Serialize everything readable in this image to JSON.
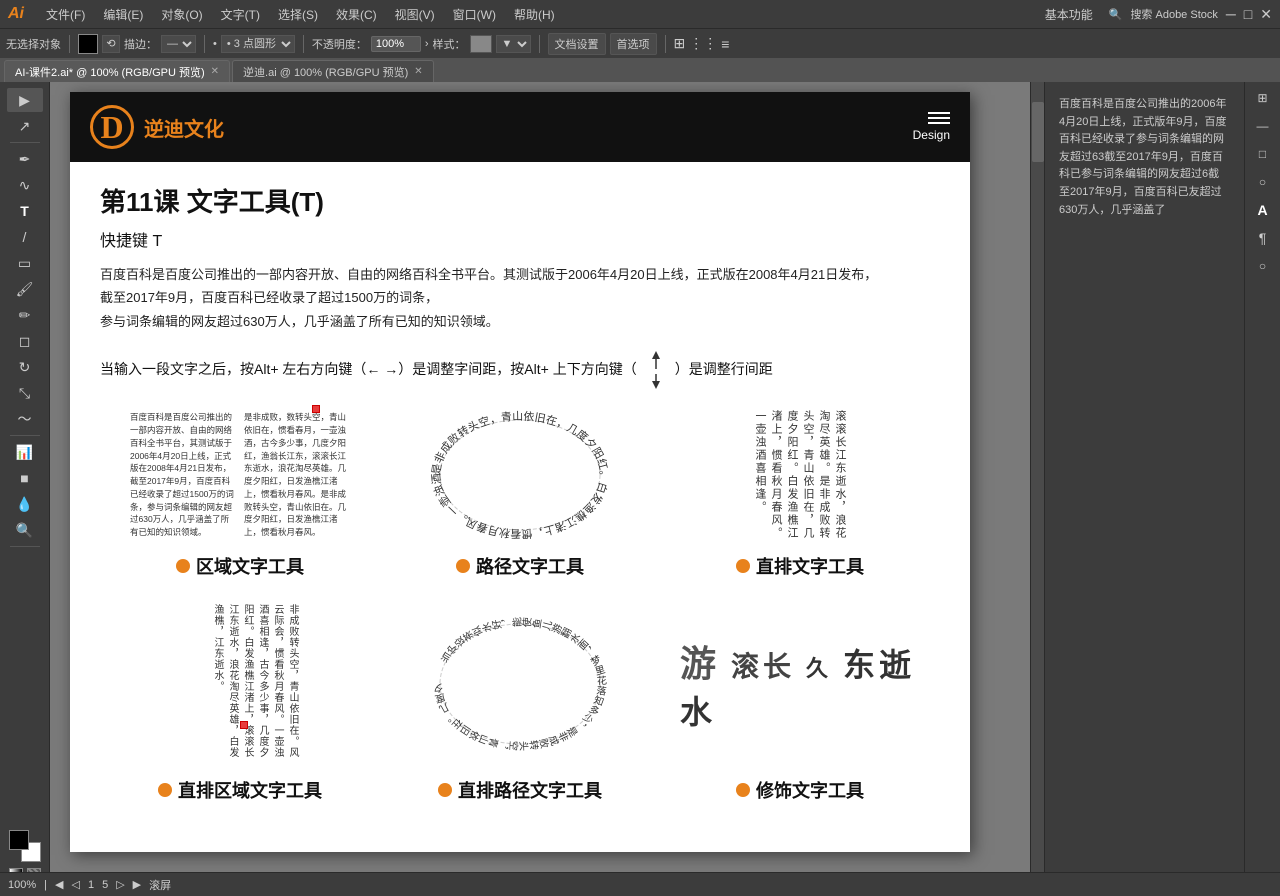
{
  "app": {
    "logo": "Ai",
    "logo_color": "#e8821c"
  },
  "menubar": {
    "items": [
      "文件(F)",
      "编辑(E)",
      "对象(O)",
      "文字(T)",
      "选择(S)",
      "效果(C)",
      "视图(V)",
      "窗口(W)",
      "帮助(H)"
    ],
    "right": {
      "mode": "基本功能",
      "search_placeholder": "搜索 Adobe Stock"
    }
  },
  "toolbar": {
    "no_selection": "无选择对象",
    "blend": "描边：",
    "point_type": "• 3 点圆形",
    "opacity_label": "不透明度：",
    "opacity_value": "100%",
    "style_label": "样式：",
    "doc_settings": "文档设置",
    "prefs": "首选项"
  },
  "tabs": [
    {
      "label": "AI-课件2.ai* @ 100% (RGB/GPU 预览)",
      "active": true
    },
    {
      "label": "逆迪.ai @ 100% (RGB/GPU 预览)",
      "active": false
    }
  ],
  "document": {
    "logo_symbol": "D",
    "logo_text": "逆迪文化",
    "design_label": "Design",
    "lesson_title": "第11课   文字工具(T)",
    "shortcut": "快捷键 T",
    "description_lines": [
      "百度百科是百度公司推出的一部内容开放、自由的网络百科全书平台。其测试版于2006年4月20日上线，正式版在2008年4月21日发布，",
      "截至2017年9月，百度百科已经收录了超过1500万的词条，",
      "参与词条编辑的网友超过630万人，几乎涵盖了所有已知的知识领域。"
    ],
    "direction_text": "当输入一段文字之后，按Alt+ 左右方向键（← →）是调整字间距，按Alt+ 上下方向键（",
    "direction_text2": "）是调整行间距",
    "tools": [
      {
        "id": "area",
        "label": "区域文字工具",
        "demo_text": "百度百科是百度公司推出的一部内容开放、自由的网络百科全书平台，其测试版于2006年4月20日上线，正式版在2008年4月21日发布，截至2017年9月，百度百科已经收录了超过1500万的词条，参与词条编辑的网友超过630万人，几乎涵盖了所有已知的知识领域。"
      },
      {
        "id": "path",
        "label": "路径文字工具",
        "demo_text": "是非成败转头空，青山依旧在，几度夕阳红。白发渔樵江渚上，惯看秋月春风。一壶浊酒喜相逢，古今多少事，都付笑谈中。"
      },
      {
        "id": "vertical",
        "label": "直排文字工具",
        "demo_text": "滚滚长江东逝水，浪花淘尽英雄。是非成败转头空，青山依旧在，几度夕阳红。白发渔樵江渚上，惯看秋月春风。"
      }
    ],
    "tools_bottom": [
      {
        "id": "vertical-area",
        "label": "直排区域文字工具"
      },
      {
        "id": "vertical-path",
        "label": "直排路径文字工具"
      },
      {
        "id": "decoration",
        "label": "修饰文字工具"
      }
    ]
  },
  "right_panel": {
    "text": "百度百科是百度公司推出的2006年4月20日上线，正式版年9月，百度百科已经收录了参与词条编辑的网友超过63截至2017年9月，百度百科已参与词条编辑的网友超过6截至2017年9月，百度百科已友超过630万人，几乎涵盖了"
  },
  "status_bar": {
    "zoom": "100%",
    "page": "1",
    "total_pages": "5",
    "info": "滚屏"
  },
  "colors": {
    "orange": "#e8821c",
    "dark_bg": "#111111",
    "panel_bg": "#3c3c3c",
    "canvas_bg": "#7a7a7a"
  }
}
